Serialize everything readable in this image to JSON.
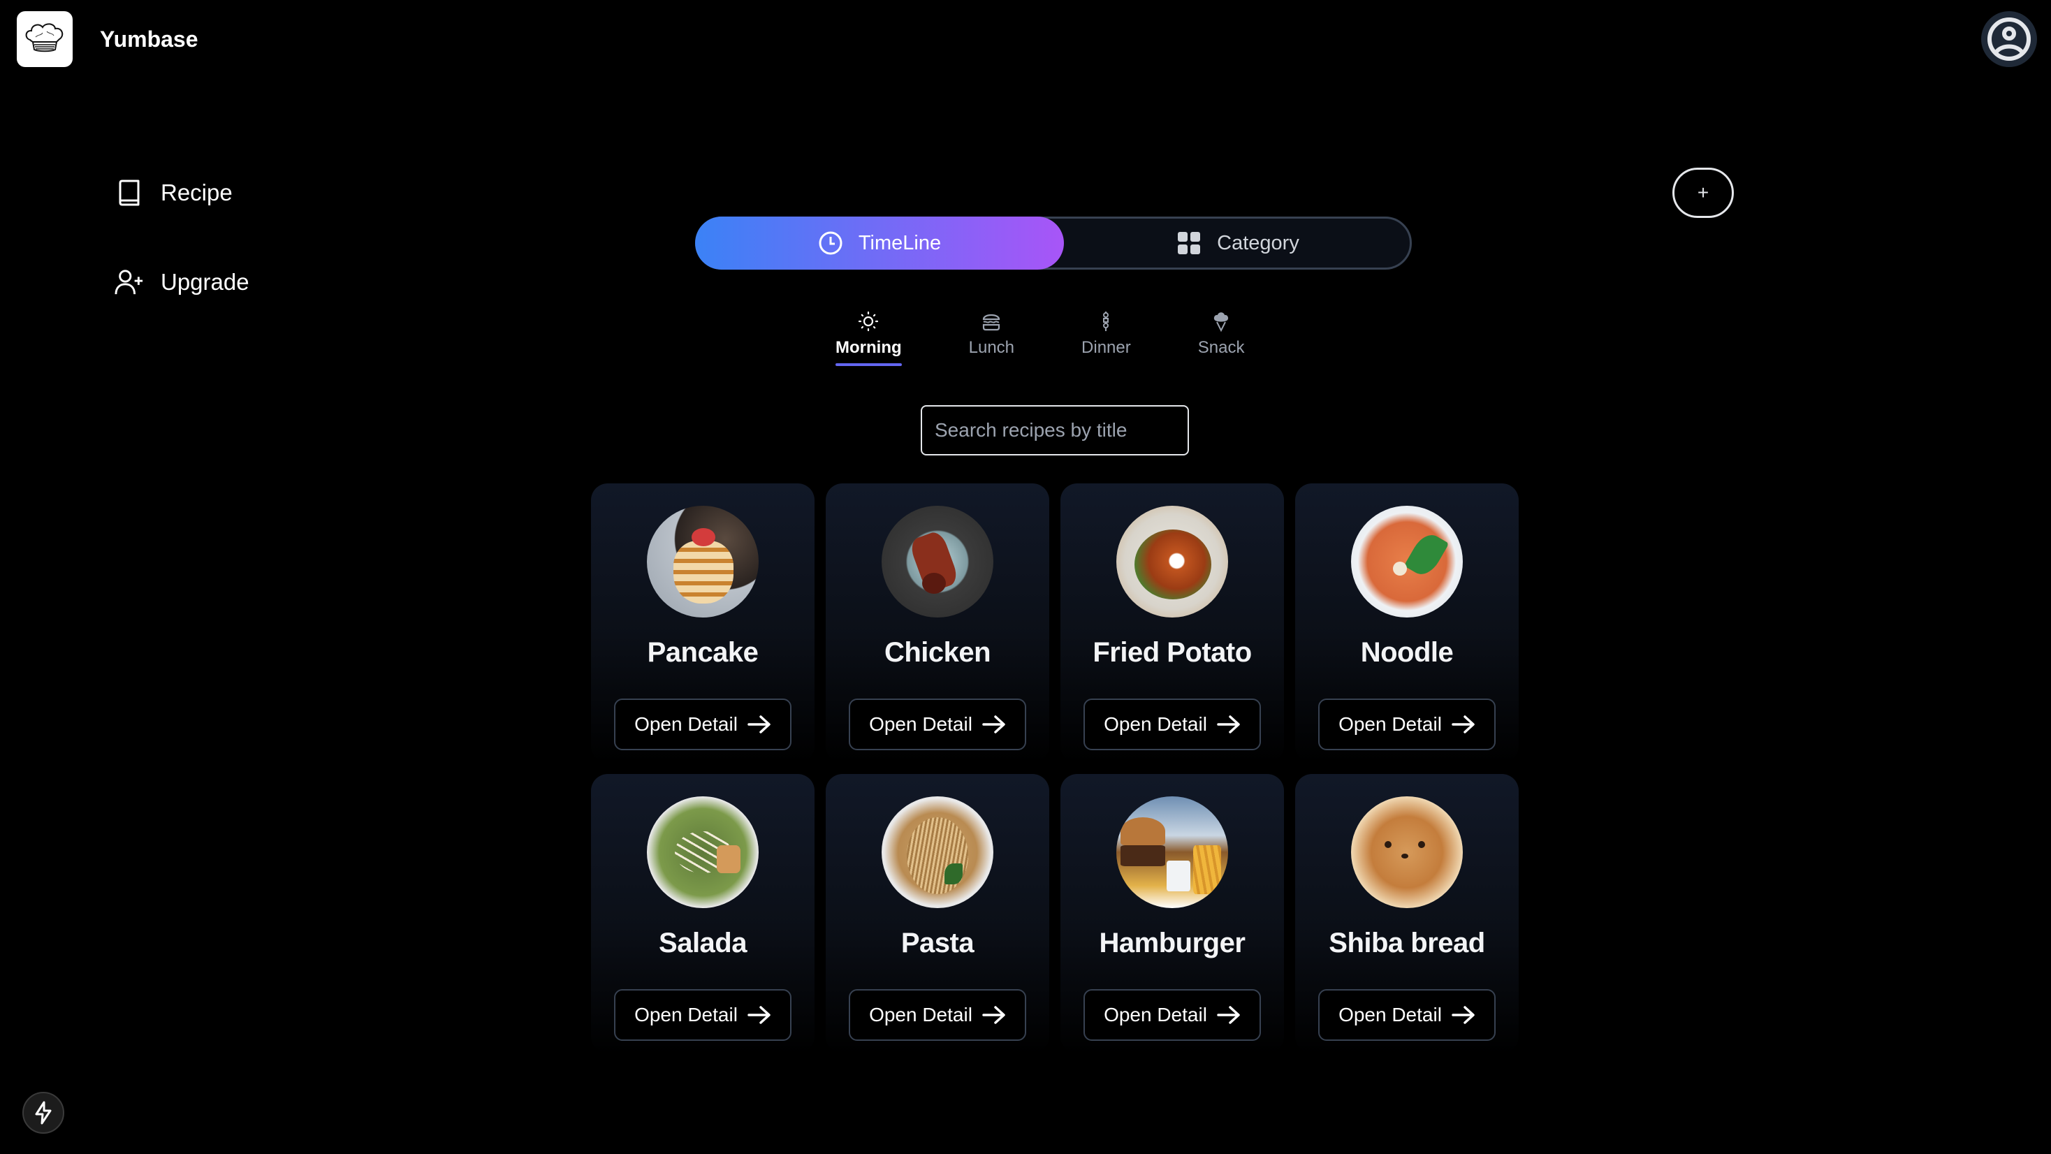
{
  "app": {
    "name": "Yumbase",
    "logo_icon": "chef-hat-icon",
    "profile_icon": "user-circle-icon"
  },
  "sidebar": {
    "items": [
      {
        "label": "Recipe",
        "icon": "book-icon"
      },
      {
        "label": "Upgrade",
        "icon": "user-plus-icon"
      }
    ]
  },
  "add_button": {
    "label": "+"
  },
  "view_toggle": {
    "options": [
      {
        "label": "TimeLine",
        "icon": "clock-icon",
        "active": true
      },
      {
        "label": "Category",
        "icon": "grid-icon",
        "active": false
      }
    ]
  },
  "meal_tabs": [
    {
      "label": "Morning",
      "icon": "sun-icon",
      "active": true
    },
    {
      "label": "Lunch",
      "icon": "burger-icon",
      "active": false
    },
    {
      "label": "Dinner",
      "icon": "skewer-icon",
      "active": false
    },
    {
      "label": "Snack",
      "icon": "ice-cream-icon",
      "active": false
    }
  ],
  "search": {
    "placeholder": "Search recipes by title",
    "value": ""
  },
  "recipes": [
    {
      "title": "Pancake",
      "button": "Open Detail"
    },
    {
      "title": "Chicken",
      "button": "Open Detail"
    },
    {
      "title": "Fried Potato",
      "button": "Open Detail"
    },
    {
      "title": "Noodle",
      "button": "Open Detail"
    },
    {
      "title": "Salada",
      "button": "Open Detail"
    },
    {
      "title": "Pasta",
      "button": "Open Detail"
    },
    {
      "title": "Hamburger",
      "button": "Open Detail"
    },
    {
      "title": "Shiba bread",
      "button": "Open Detail"
    }
  ],
  "colors": {
    "background": "#000000",
    "accent_gradient_start": "#3b82f6",
    "accent_gradient_end": "#a855f7",
    "tab_underline": "#6366f1",
    "card_top": "#111827"
  },
  "footer": {
    "bolt_icon": "bolt-icon"
  }
}
